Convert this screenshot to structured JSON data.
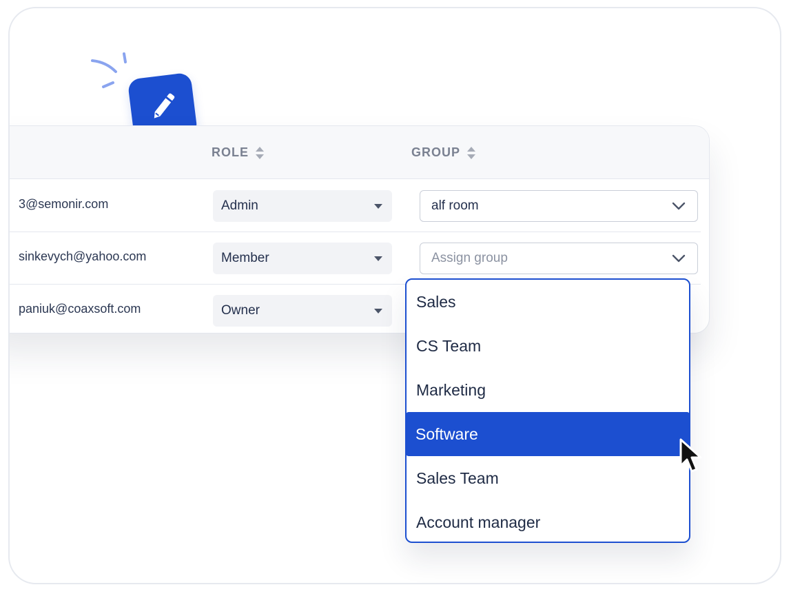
{
  "table": {
    "headers": {
      "role": "ROLE",
      "group": "GROUP"
    },
    "rows": [
      {
        "email": "3@semonir.com",
        "role": "Admin",
        "group": "alf room",
        "group_is_placeholder": false
      },
      {
        "email": "sinkevych@yahoo.com",
        "role": "Member",
        "group": "Assign group",
        "group_is_placeholder": true
      },
      {
        "email": "paniuk@coaxsoft.com",
        "role": "Owner",
        "group": "",
        "group_is_placeholder": false
      }
    ]
  },
  "dropdown": {
    "options": [
      "Sales",
      "CS Team",
      "Marketing",
      "Software",
      "Sales Team",
      "Account manager"
    ],
    "highlighted": "Software"
  },
  "icons": {
    "edit_badge": "pencil-icon",
    "sort": "sort-icon",
    "role_caret": "caret-down-icon",
    "group_chevron": "chevron-down-icon",
    "pointer": "mouse-cursor-icon"
  },
  "colors": {
    "accent": "#1c4fd0",
    "deco_stroke": "#8aa4ef",
    "header_bg": "#f7f8fa",
    "role_select_bg": "#f2f3f6"
  }
}
